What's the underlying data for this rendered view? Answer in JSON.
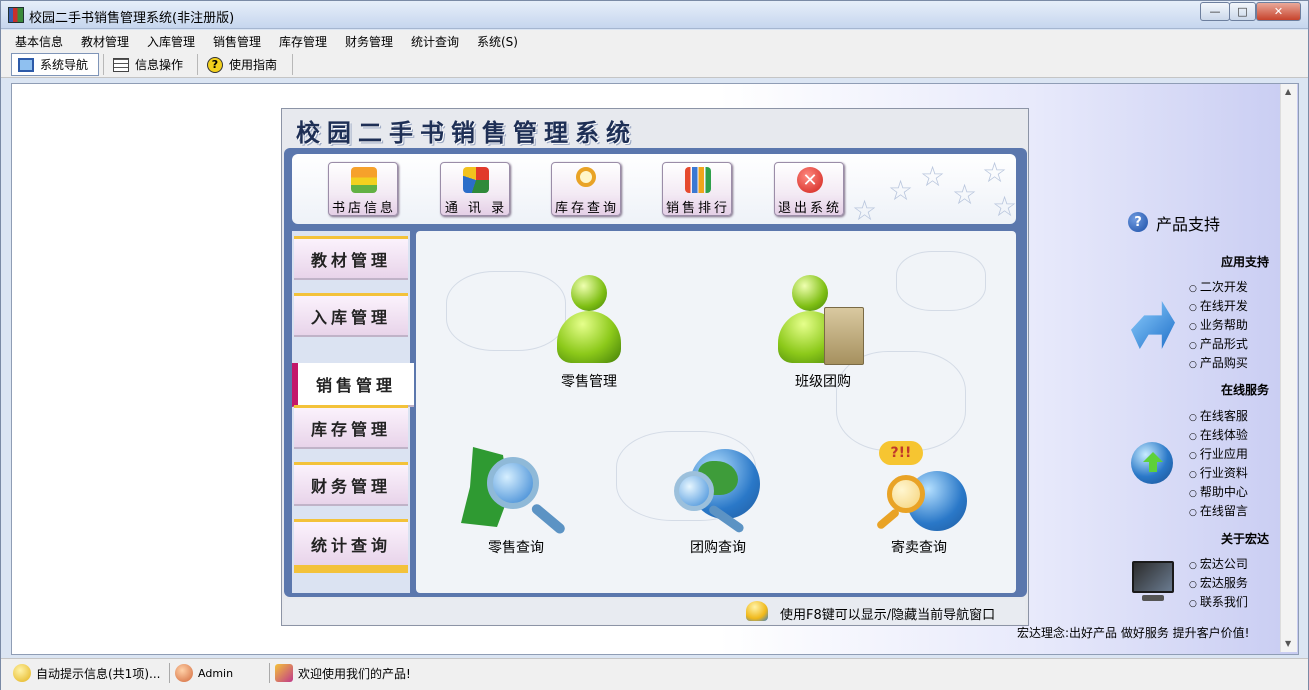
{
  "window": {
    "title": "校园二手书销售管理系统(非注册版)"
  },
  "menubar": [
    "基本信息",
    "教材管理",
    "入库管理",
    "销售管理",
    "库存管理",
    "财务管理",
    "统计查询",
    "系统(S)"
  ],
  "toolbar": {
    "nav": "系统导航",
    "info": "信息操作",
    "guide": "使用指南"
  },
  "panel": {
    "title": "校园二手书销售管理系统",
    "top_buttons": [
      "书店信息",
      "通 讯 录",
      "库存查询",
      "销售排行",
      "退出系统"
    ],
    "nav_items": [
      "教材管理",
      "入库管理",
      "销售管理",
      "库存管理",
      "财务管理",
      "统计查询"
    ],
    "active_nav": "销售管理",
    "functions": [
      "零售管理",
      "班级团购",
      "零售查询",
      "团购查询",
      "寄卖查询"
    ],
    "status_tip": "使用F8键可以显示/隐藏当前导航窗口"
  },
  "right": {
    "title": "产品支持",
    "app_support": {
      "heading": "应用支持",
      "items": [
        "二次开发",
        "在线开发",
        "业务帮助",
        "产品形式",
        "产品购买"
      ]
    },
    "online_service": {
      "heading": "在线服务",
      "items": [
        "在线客服",
        "在线体验",
        "行业应用",
        "行业资料",
        "帮助中心",
        "在线留言"
      ]
    },
    "about": {
      "heading": "关于宏达",
      "items": [
        "宏达公司",
        "宏达服务",
        "联系我们"
      ]
    },
    "slogan": "宏达理念:出好产品 做好服务 提升客户价值!"
  },
  "statusbar": {
    "tips": "自动提示信息(共1项)...",
    "user": "Admin",
    "welcome": "欢迎使用我们的产品!"
  },
  "colors": {
    "accent_nav": "#c3176a",
    "panel_frame": "#5b77ad",
    "title_text": "#1e2f55"
  },
  "icons": [
    "app-icon",
    "monitor-icon",
    "grid-icon",
    "help-icon",
    "bookstore-icon",
    "contacts-icon",
    "magnifier-icon",
    "bar-chart-icon",
    "exit-icon",
    "user-icon",
    "user-bag-icon",
    "map-search-icon",
    "globe-search-icon",
    "question-globe-icon",
    "lamp-user-icon",
    "question-icon",
    "arrow-icon",
    "globe-arrow-icon",
    "monitor-large-icon"
  ]
}
